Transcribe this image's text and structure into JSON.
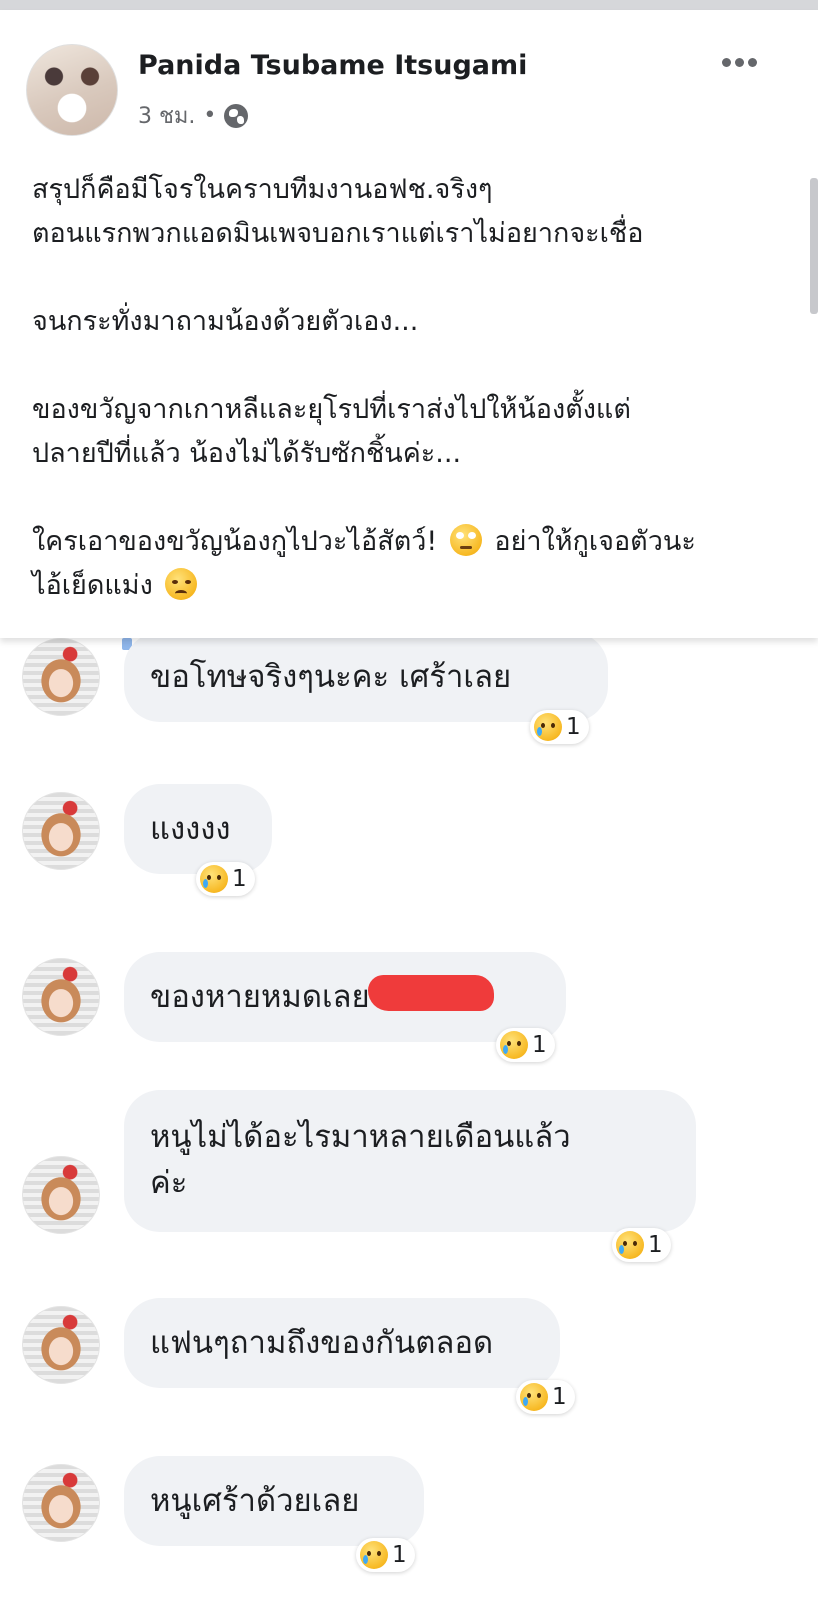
{
  "post": {
    "author": "Panida Tsubame Itsugami",
    "time": "3 ชม.",
    "separator": "•",
    "paragraphs": [
      {
        "lines": [
          "สรุปก็คือมีโจรในคราบทีมงานอฟช.จริงๆ",
          "ตอนแรกพวกแอดมินเพจบอกเราแต่เราไม่อยากจะเชื่อ"
        ]
      },
      {
        "lines": [
          "จนกระทั่งมาถามน้องด้วยตัวเอง..."
        ]
      },
      {
        "lines": [
          "ของขวัญจากเกาหลีและยุโรปที่เราส่งไปให้น้องตั้งแต่",
          "ปลายปีที่แล้ว น้องไม่ได้รับซักชิ้นค่ะ..."
        ]
      }
    ],
    "last_para": {
      "part1": "ใครเอาของขวัญน้องกูไปวะไอ้สัตว์! ",
      "emoji1": "face-with-rolling-eyes",
      "part2": " อย่าให้กูเจอตัวนะ",
      "part3": "ไอ้เย็ดแม่ง ",
      "emoji2": "angry-face"
    }
  },
  "comments": [
    {
      "text_lines": [
        "ขอโทษจริงๆนะคะ เศร้าเลย"
      ],
      "reaction": "sad-face",
      "count": "1"
    },
    {
      "text_lines": [
        "แงงงง"
      ],
      "reaction": "sad-face",
      "count": "1"
    },
    {
      "text_lines": [
        "ของหายหมดเลย"
      ],
      "redacted": true,
      "reaction": "sad-face",
      "count": "1"
    },
    {
      "text_lines": [
        "หนูไม่ได้อะไรมาหลายเดือนแล้ว",
        "ค่ะ"
      ],
      "reaction": "sad-face",
      "count": "1"
    },
    {
      "text_lines": [
        "แฟนๆถามถึงของกันตลอด"
      ],
      "reaction": "sad-face",
      "count": "1"
    },
    {
      "text_lines": [
        "หนูเศร้าด้วยเลย"
      ],
      "reaction": "sad-face",
      "count": "1"
    }
  ],
  "colors": {
    "bubble": "#f0f2f5",
    "text": "#1c1e21",
    "meta": "#65676b",
    "redaction": "#ef3b3b"
  }
}
